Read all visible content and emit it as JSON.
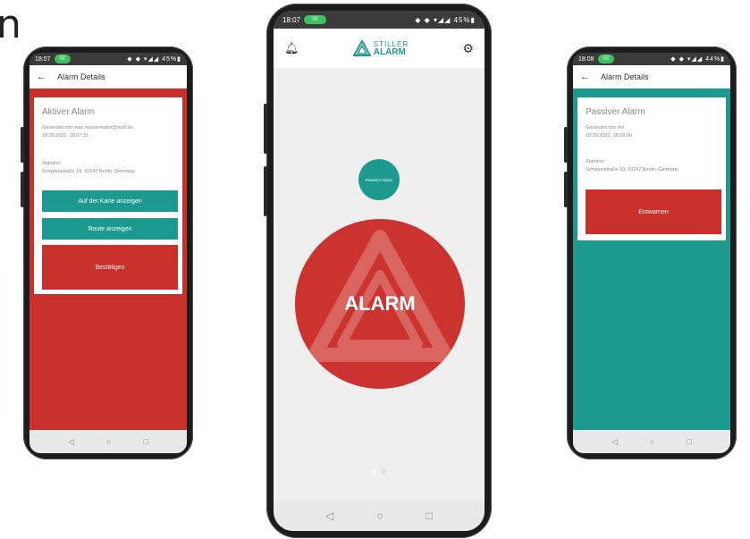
{
  "fragment_text": "n",
  "left_phone": {
    "status_time": "18:07",
    "status_icons": "◆ ◆ ▾◢◢ 45%▮",
    "back_icon": "←",
    "title": "Alarm Details",
    "card_title": "Aktiver Alarm",
    "sent_by": "Gesendet von max.mustermann@mail.de",
    "timestamp": "18.09.2020, 18:07:31",
    "location_label": "Standort",
    "location_value": "Schwienstraße 19, 10247 Berlin, Germany",
    "map_button": "Auf der Karte anzeigen",
    "route_button": "Route anzeigen",
    "confirm_button": "Bestätigen",
    "nav": [
      "◁",
      "○",
      "□"
    ],
    "colors": {
      "accent": "#c9302c",
      "teal": "#1d9a8f"
    }
  },
  "center_phone": {
    "status_time": "18:07",
    "status_icons": "◆ ◆ ▾◢◢ 45%▮",
    "logo_top": "STILLER",
    "logo_bottom": "ALARM",
    "passive_button": "Passiver Alarm",
    "alarm_button": "ALARM",
    "nav": [
      "◁",
      "○",
      "□"
    ],
    "colors": {
      "alarm": "#cc3330",
      "teal": "#1d9a8f"
    }
  },
  "right_phone": {
    "status_time": "18:08",
    "status_icons": "◆ ◆ ▾◢◢ 44%▮",
    "back_icon": "←",
    "title": "Alarm Details",
    "card_title": "Passiver Alarm",
    "sent_by": "Gesendet von mir",
    "timestamp": "18.09.2020, 18:09:00",
    "location_label": "Standort",
    "location_value": "Schwienstraße 19, 10247 Berlin, Germany",
    "disarm_button": "Entwarnen",
    "nav": [
      "◁",
      "○",
      "□"
    ],
    "colors": {
      "teal": "#1d9a8f",
      "accent": "#c9302c"
    }
  }
}
